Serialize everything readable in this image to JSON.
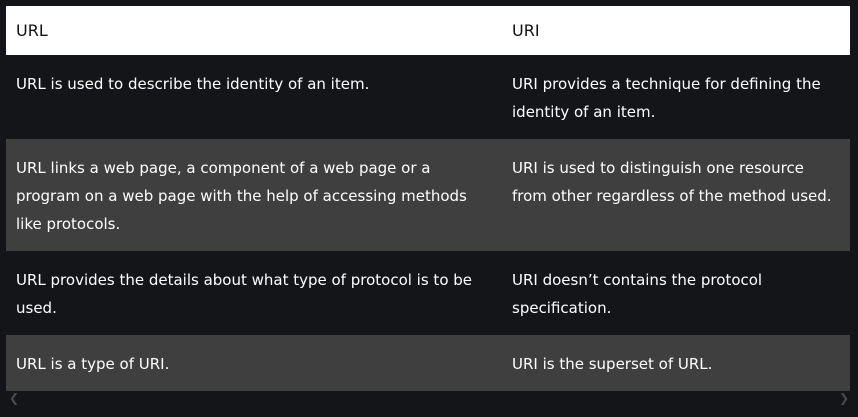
{
  "table": {
    "headers": [
      "URL",
      "URI"
    ],
    "rows": [
      [
        "URL is used to describe the identity of an item.",
        "URI provides a technique for defining the identity of an item."
      ],
      [
        "URL links a web page, a component of a web page or a program on a web page with the help of accessing methods like protocols.",
        "URI is used to distinguish one resource from other regardless of the method used."
      ],
      [
        "URL provides the details about what type of protocol is to be used.",
        "URI doesn’t contains the protocol specification."
      ],
      [
        "URL is a type of URI.",
        "URI is the superset of URL."
      ]
    ]
  },
  "scrollbar": {
    "left_icon": "chevron-left-icon",
    "right_icon": "chevron-right-icon"
  }
}
